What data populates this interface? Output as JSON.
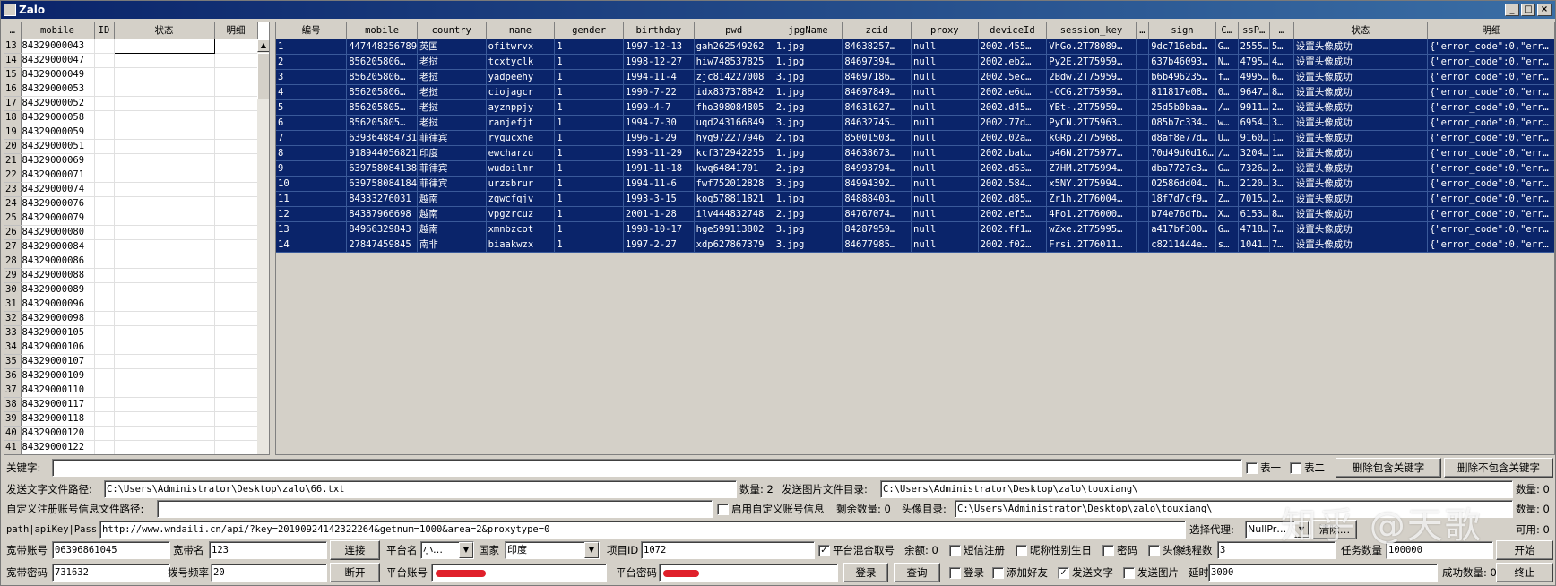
{
  "window": {
    "title": "Zalo",
    "min": "_",
    "max": "□",
    "close": "×"
  },
  "left_table": {
    "headers": [
      "…",
      "mobile",
      "ID",
      "状态",
      "明细"
    ],
    "rows": [
      [
        "13",
        "84329000043"
      ],
      [
        "14",
        "84329000047"
      ],
      [
        "15",
        "84329000049"
      ],
      [
        "16",
        "84329000053"
      ],
      [
        "17",
        "84329000052"
      ],
      [
        "18",
        "84329000058"
      ],
      [
        "19",
        "84329000059"
      ],
      [
        "20",
        "84329000051"
      ],
      [
        "21",
        "84329000069"
      ],
      [
        "22",
        "84329000071"
      ],
      [
        "23",
        "84329000074"
      ],
      [
        "24",
        "84329000076"
      ],
      [
        "25",
        "84329000079"
      ],
      [
        "26",
        "84329000080"
      ],
      [
        "27",
        "84329000084"
      ],
      [
        "28",
        "84329000086"
      ],
      [
        "29",
        "84329000088"
      ],
      [
        "30",
        "84329000089"
      ],
      [
        "31",
        "84329000096"
      ],
      [
        "32",
        "84329000098"
      ],
      [
        "33",
        "84329000105"
      ],
      [
        "34",
        "84329000106"
      ],
      [
        "35",
        "84329000107"
      ],
      [
        "36",
        "84329000109"
      ],
      [
        "37",
        "84329000110"
      ],
      [
        "38",
        "84329000117"
      ],
      [
        "39",
        "84329000118"
      ],
      [
        "40",
        "84329000120"
      ],
      [
        "41",
        "84329000122"
      ]
    ]
  },
  "right_table": {
    "headers": [
      "编号",
      "mobile",
      "country",
      "name",
      "gender",
      "birthday",
      "pwd",
      "jpgName",
      "zcid",
      "proxy",
      "deviceId",
      "session_key",
      "…",
      "sign",
      "C…",
      "ssP…",
      "…",
      "状态",
      "明细"
    ],
    "rows": [
      [
        "1",
        "447448256789",
        "英国",
        "ofitwrvx",
        "1",
        "1997-12-13",
        "gah262549262",
        "1.jpg",
        "84638257…",
        "null",
        "2002.455…",
        "VhGo.2T78089…",
        "",
        "9dc716ebd…",
        "G…",
        "2555…",
        "5…",
        "设置头像成功",
        "{\"error_code\":0,\"err…"
      ],
      [
        "2",
        "856205806…",
        "老挝",
        "tcxtyclk",
        "1",
        "1998-12-27",
        "hiw748537825",
        "1.jpg",
        "84697394…",
        "null",
        "2002.eb2…",
        "Py2E.2T75959…",
        "",
        "637b46093…",
        "N…",
        "4795…",
        "4…",
        "设置头像成功",
        "{\"error_code\":0,\"err…"
      ],
      [
        "3",
        "856205806…",
        "老挝",
        "yadpeehy",
        "1",
        "1994-11-4",
        "zjc814227008",
        "3.jpg",
        "84697186…",
        "null",
        "2002.5ec…",
        "2Bdw.2T75959…",
        "",
        "b6b496235…",
        "f…",
        "4995…",
        "6…",
        "设置头像成功",
        "{\"error_code\":0,\"err…"
      ],
      [
        "4",
        "856205806…",
        "老挝",
        "ciojagcr",
        "1",
        "1990-7-22",
        "idx837378842",
        "1.jpg",
        "84697849…",
        "null",
        "2002.e6d…",
        "-OCG.2T75959…",
        "",
        "811817e08…",
        "0…",
        "9647…",
        "8…",
        "设置头像成功",
        "{\"error_code\":0,\"err…"
      ],
      [
        "5",
        "856205805…",
        "老挝",
        "ayznppjy",
        "1",
        "1999-4-7",
        "fho398084805",
        "2.jpg",
        "84631627…",
        "null",
        "2002.d45…",
        "YBt-.2T75959…",
        "",
        "25d5b0baa…",
        "/…",
        "9911…",
        "2…",
        "设置头像成功",
        "{\"error_code\":0,\"err…"
      ],
      [
        "6",
        "856205805…",
        "老挝",
        "ranjefjt",
        "1",
        "1994-7-30",
        "uqd243166849",
        "3.jpg",
        "84632745…",
        "null",
        "2002.77d…",
        "PyCN.2T75963…",
        "",
        "085b7c334…",
        "w…",
        "6954…",
        "3…",
        "设置头像成功",
        "{\"error_code\":0,\"err…"
      ],
      [
        "7",
        "639364884731",
        "菲律宾",
        "ryqucxhe",
        "1",
        "1996-1-29",
        "hyg972277946",
        "2.jpg",
        "85001503…",
        "null",
        "2002.02a…",
        "kGRp.2T75968…",
        "",
        "d8af8e77d…",
        "U…",
        "9160…",
        "1…",
        "设置头像成功",
        "{\"error_code\":0,\"err…"
      ],
      [
        "8",
        "918944056821",
        "印度",
        "ewcharzu",
        "1",
        "1993-11-29",
        "kcf372942255",
        "1.jpg",
        "84638673…",
        "null",
        "2002.bab…",
        "o46N.2T75977…",
        "",
        "70d49d0d16…",
        "/…",
        "3204…",
        "1…",
        "设置头像成功",
        "{\"error_code\":0,\"err…"
      ],
      [
        "9",
        "639758084138",
        "菲律宾",
        "wudoilmr",
        "1",
        "1991-11-18",
        "kwq64841701",
        "2.jpg",
        "84993794…",
        "null",
        "2002.d53…",
        "Z7HM.2T75994…",
        "",
        "dba7727c3…",
        "G…",
        "7326…",
        "2…",
        "设置头像成功",
        "{\"error_code\":0,\"err…"
      ],
      [
        "10",
        "639758084184",
        "菲律宾",
        "urzsbrur",
        "1",
        "1994-11-6",
        "fwf752012828",
        "3.jpg",
        "84994392…",
        "null",
        "2002.584…",
        "x5NY.2T75994…",
        "",
        "02586dd04…",
        "h…",
        "2120…",
        "3…",
        "设置头像成功",
        "{\"error_code\":0,\"err…"
      ],
      [
        "11",
        "84333276031",
        "越南",
        "zqwcfqjv",
        "1",
        "1993-3-15",
        "kog578811821",
        "1.jpg",
        "84888403…",
        "null",
        "2002.d85…",
        "Zr1h.2T76004…",
        "",
        "18f7d7cf9…",
        "Z…",
        "7015…",
        "2…",
        "设置头像成功",
        "{\"error_code\":0,\"err…"
      ],
      [
        "12",
        "84387966698",
        "越南",
        "vpgzrcuz",
        "1",
        "2001-1-28",
        "ilv444832748",
        "2.jpg",
        "84767074…",
        "null",
        "2002.ef5…",
        "4Fo1.2T76000…",
        "",
        "b74e76dfb…",
        "X…",
        "6153…",
        "8…",
        "设置头像成功",
        "{\"error_code\":0,\"err…"
      ],
      [
        "13",
        "84966329843",
        "越南",
        "xmnbzcot",
        "1",
        "1998-10-17",
        "hge599113802",
        "3.jpg",
        "84287959…",
        "null",
        "2002.ff1…",
        "wZxe.2T75995…",
        "",
        "a417bf300…",
        "G…",
        "4718…",
        "7…",
        "设置头像成功",
        "{\"error_code\":0,\"err…"
      ],
      [
        "14",
        "27847459845",
        "南非",
        "biaakwzx",
        "1",
        "1997-2-27",
        "xdp627867379",
        "3.jpg",
        "84677985…",
        "null",
        "2002.f02…",
        "Frsi.2T76011…",
        "",
        "c8211444e…",
        "s…",
        "1041…",
        "7…",
        "设置头像成功",
        "{\"error_code\":0,\"err…"
      ]
    ]
  },
  "keyword": {
    "label": "关键字:",
    "value": "",
    "t1": "表一",
    "t2": "表二",
    "btn_delete_contains": "删除包含关键字",
    "btn_delete_not_contains": "删除不包含关键字"
  },
  "send_text": {
    "label": "发送文字文件路径:",
    "value": "C:\\Users\\Administrator\\Desktop\\zalo\\66.txt",
    "count_label": "数量: 2",
    "img_label": "发送图片文件目录:",
    "img_value": "C:\\Users\\Administrator\\Desktop\\zalo\\touxiang\\",
    "img_count": "数量: 0"
  },
  "custom_reg": {
    "label": "自定义注册账号信息文件路径:",
    "value": "",
    "enable_label": "启用自定义账号信息",
    "remain": "剩余数量: 0",
    "avatar_label": "头像目录:",
    "avatar_value": "C:\\Users\\Administrator\\Desktop\\zalo\\touxiang\\",
    "avatar_count": "数量: 0"
  },
  "api": {
    "label": "path|apiKey|Pass:",
    "value": "http://www.wndaili.cn/api/?key=20190924142322264&getnum=1000&area=2&proxytype=0",
    "proxy_label": "选择代理:",
    "proxy_value": "NullPr…",
    "clear_label": "清除…",
    "available": "可用: 0"
  },
  "row5": {
    "bb_account_label": "宽带账号",
    "bb_account": "06396861045",
    "bb_name_label": "宽带名",
    "bb_name": "123",
    "connect": "连接",
    "platform_name_label": "平台名",
    "platform_name": "小…",
    "country_label": "国家",
    "country": "印度",
    "project_id_label": "项目ID",
    "project_id": "1072",
    "mix_label": "平台混合取号",
    "balance": "余额: 0",
    "sms_label": "短信注册",
    "nick_gender_label": "昵称性别生日",
    "pwd_label": "密码",
    "avatar_label": "头像",
    "threads_label": "线程数",
    "threads": "3",
    "tasks_label": "任务数量",
    "tasks": "100000",
    "start": "开始"
  },
  "row6": {
    "bb_pwd_label": "宽带密码",
    "bb_pwd": "731632",
    "dial_freq_label": "拨号频率",
    "dial_freq": "20",
    "disconnect": "断开",
    "platform_account_label": "平台账号",
    "platform_pwd_label": "平台密码",
    "login_btn": "登录",
    "query_btn": "查询",
    "login_chk": "登录",
    "add_friend": "添加好友",
    "send_text_chk": "发送文字",
    "send_img_chk": "发送图片",
    "delay_label": "延时",
    "delay": "3000",
    "success_label": "成功数量: 0",
    "stop": "终止"
  },
  "watermark": "知乎 @天歌"
}
